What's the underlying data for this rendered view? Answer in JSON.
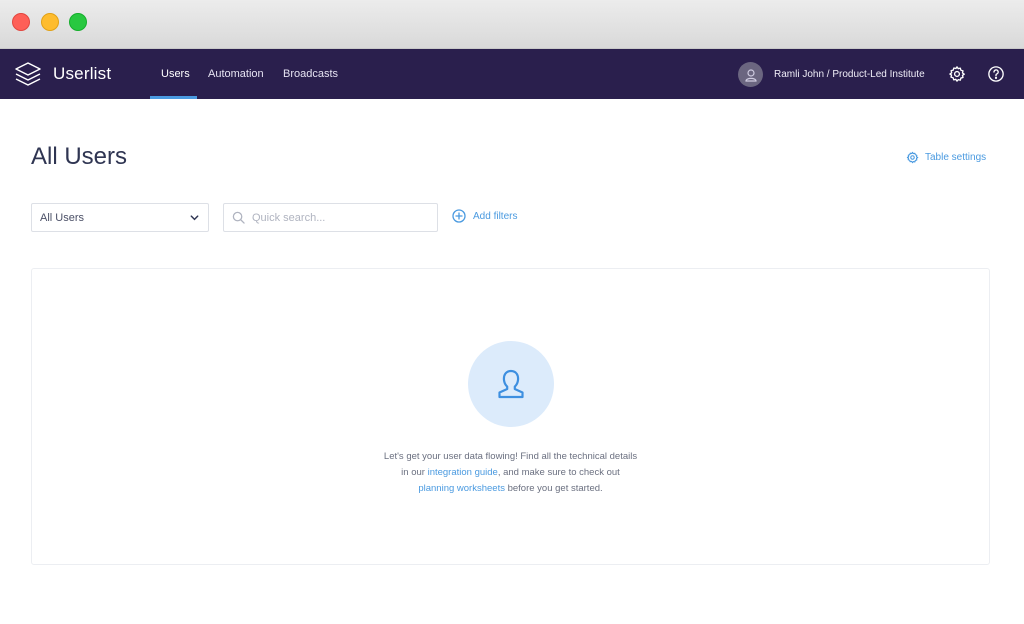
{
  "app": {
    "brand": "Userlist"
  },
  "nav": {
    "tabs": [
      {
        "label": "Users",
        "active": true
      },
      {
        "label": "Automation",
        "active": false
      },
      {
        "label": "Broadcasts",
        "active": false
      }
    ],
    "account_label": "Ramli John / Product-Led Institute",
    "icons": [
      "layers-logo-icon",
      "user-avatar-icon",
      "gear-icon",
      "help-icon"
    ]
  },
  "main": {
    "title": "All Users",
    "table_settings_label": "Table settings",
    "segment_select": {
      "value": "All Users"
    },
    "search": {
      "placeholder": "Quick search...",
      "value": ""
    },
    "add_filters_label": "Add filters",
    "empty_state": {
      "line1": "Let's get your user data flowing! Find all the technical details",
      "line2_prefix": "in our ",
      "integration_link": "integration guide",
      "line2_suffix": ", and make sure to check out",
      "planning_link": "planning worksheets",
      "line3_suffix": " before you get started."
    }
  },
  "colors": {
    "nav_bg": "#2a1f4d",
    "accent": "#4a9ae0",
    "empty_circle": "#dcebfb"
  }
}
